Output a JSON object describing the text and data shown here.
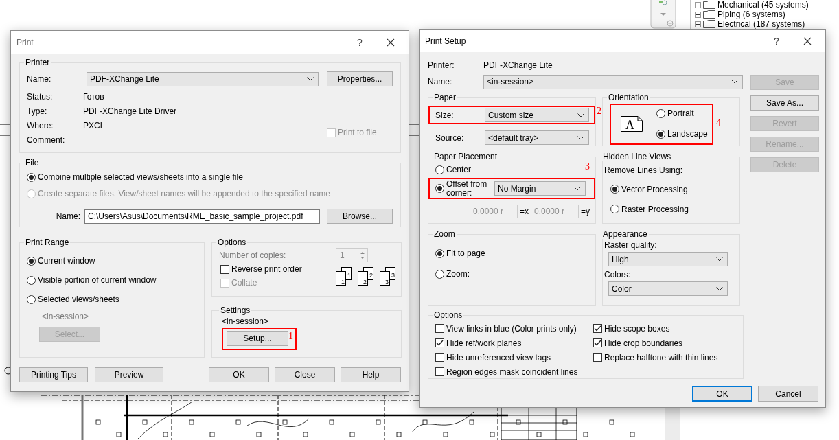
{
  "background": {
    "tree_items": [
      {
        "label": "Mechanical (45 systems)",
        "expanded": false
      },
      {
        "label": "Piping (6 systems)",
        "expanded": false
      },
      {
        "label": "Electrical (187 systems)",
        "expanded": false
      }
    ]
  },
  "print_dialog": {
    "title": "Print",
    "help_button": "?",
    "printer": {
      "legend": "Printer",
      "name_label": "Name:",
      "name_value": "PDF-XChange Lite",
      "properties_button": "Properties...",
      "info": [
        {
          "label": "Status:",
          "value": "Готов"
        },
        {
          "label": "Type:",
          "value": "PDF-XChange Lite Driver"
        },
        {
          "label": "Where:",
          "value": "PXCL"
        },
        {
          "label": "Comment:"
        }
      ],
      "print_to_file": {
        "label": "Print to file",
        "checked": false,
        "disabled": true
      }
    },
    "file": {
      "legend": "File",
      "options": [
        {
          "label": "Combine multiple selected views/sheets into a single file",
          "selected": true,
          "disabled": false
        },
        {
          "label": "Create separate files. View/sheet names will be appended to the specified name",
          "selected": false,
          "disabled": true
        }
      ],
      "name_label": "Name:",
      "name_value": "C:\\Users\\Asus\\Documents\\RME_basic_sample_project.pdf",
      "browse_button": "Browse..."
    },
    "print_range": {
      "legend": "Print Range",
      "options": [
        {
          "label": "Current window",
          "selected": true
        },
        {
          "label": "Visible portion of current window",
          "selected": false
        },
        {
          "label": "Selected views/sheets",
          "selected": false
        }
      ],
      "session": "<in-session>",
      "select_button": {
        "label": "Select...",
        "disabled": true
      }
    },
    "options": {
      "legend": "Options",
      "copies_label": "Number of copies:",
      "copies_value": "1",
      "copies_disabled": true,
      "checkboxes": [
        {
          "label": "Reverse print order",
          "checked": false,
          "disabled": false
        },
        {
          "label": "Collate",
          "checked": false,
          "disabled": true
        }
      ],
      "collate_icons": [
        {
          "back": "1",
          "front": "1"
        },
        {
          "back": "2",
          "front": "2"
        },
        {
          "back": "3",
          "front": "3"
        }
      ]
    },
    "settings": {
      "legend": "Settings",
      "session": "<in-session>",
      "setup_button": "Setup...",
      "callout": "1"
    },
    "left_buttons": [
      {
        "label": "Printing Tips"
      },
      {
        "label": "Preview"
      }
    ],
    "right_buttons": [
      {
        "label": "OK"
      },
      {
        "label": "Close"
      },
      {
        "label": "Help"
      }
    ]
  },
  "print_setup": {
    "title": "Print Setup",
    "help_button": "?",
    "printer_label": "Printer:",
    "printer_value": "PDF-XChange Lite",
    "name_label": "Name:",
    "name_value": "<in-session>",
    "side_buttons": [
      {
        "label": "Save",
        "disabled": true
      },
      {
        "label": "Save As...",
        "disabled": false
      },
      {
        "label": "Revert",
        "disabled": true
      },
      {
        "label": "Rename...",
        "disabled": true
      },
      {
        "label": "Delete",
        "disabled": true
      }
    ],
    "paper": {
      "legend": "Paper",
      "fields": [
        {
          "label": "Size:",
          "value": "Custom size",
          "callout": "2"
        },
        {
          "label": "Source:",
          "value": "<default tray>"
        }
      ]
    },
    "orientation": {
      "legend": "Orientation",
      "icon_letter": "A",
      "callout": "4",
      "options": [
        {
          "label": "Portrait",
          "selected": false
        },
        {
          "label": "Landscape",
          "selected": true
        }
      ]
    },
    "paper_placement": {
      "legend": "Paper Placement",
      "options": [
        {
          "label": "Center",
          "selected": false
        },
        {
          "label": "Offset from corner:",
          "selected": true
        }
      ],
      "margin": "No Margin",
      "callout": "3",
      "offset_x": "0.0000 r",
      "x_label": "=x",
      "offset_y": "0.0000 r",
      "y_label": "=y",
      "offsets_disabled": true
    },
    "hidden_line_views": {
      "legend": "Hidden Line Views",
      "caption": "Remove Lines Using:",
      "options": [
        {
          "label": "Vector Processing",
          "selected": true
        },
        {
          "label": "Raster Processing",
          "selected": false
        }
      ]
    },
    "zoom": {
      "legend": "Zoom",
      "options": [
        {
          "label": "Fit to page",
          "selected": true
        },
        {
          "label": "Zoom:",
          "selected": false
        }
      ]
    },
    "appearance": {
      "legend": "Appearance",
      "fields": [
        {
          "label": "Raster quality:",
          "value": "High"
        },
        {
          "label": "Colors:",
          "value": "Color"
        }
      ]
    },
    "options": {
      "legend": "Options",
      "checkboxes": [
        {
          "label": "View links in blue (Color prints only)",
          "checked": false
        },
        {
          "label": "Hide scope boxes",
          "checked": true
        },
        {
          "label": "Hide ref/work planes",
          "checked": true
        },
        {
          "label": "Hide crop boundaries",
          "checked": true
        },
        {
          "label": "Hide unreferenced view tags",
          "checked": false
        },
        {
          "label": "Replace halftone with thin lines",
          "checked": false
        },
        {
          "label": "Region edges mask coincident lines",
          "checked": false
        }
      ]
    },
    "buttons": [
      {
        "label": "OK",
        "default": true
      },
      {
        "label": "Cancel",
        "default": false
      }
    ]
  }
}
